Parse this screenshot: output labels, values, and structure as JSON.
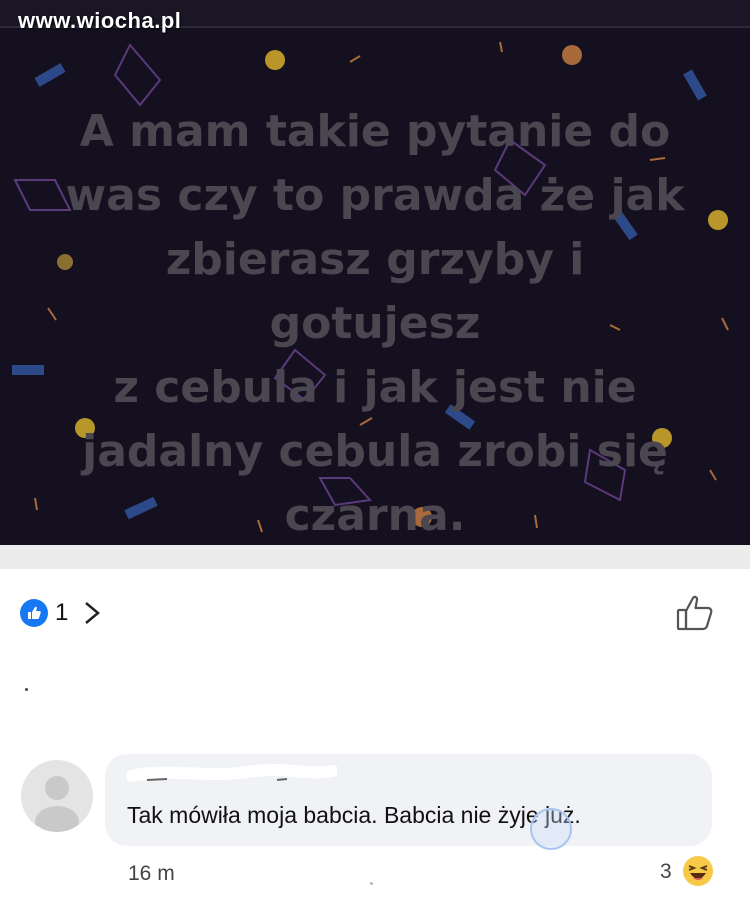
{
  "watermark": "www.wiocha.pl",
  "post": {
    "lines": [
      "A mam takie pytanie do",
      "was czy to prawda że jak",
      "zbierasz grzyby i gotujesz",
      "z cebula i jak jest nie",
      "jadalny cebula zrobi się",
      "czarna."
    ],
    "background_color": "#15101f",
    "text_color": "#4a4750"
  },
  "reactions": {
    "like_count": "1",
    "like_icon": "thumbs-up-icon",
    "chevron_icon": "chevron-right-icon",
    "like_button_icon": "thumbs-up-outline-icon",
    "accent_color": "#1877f2"
  },
  "comment": {
    "avatar_icon": "default-avatar-icon",
    "text": "Tak mówiła moja babcia. Babcia nie żyje już.",
    "time": "16 m",
    "reaction_count": "3",
    "reaction_icon": "haha-emoji-icon"
  }
}
